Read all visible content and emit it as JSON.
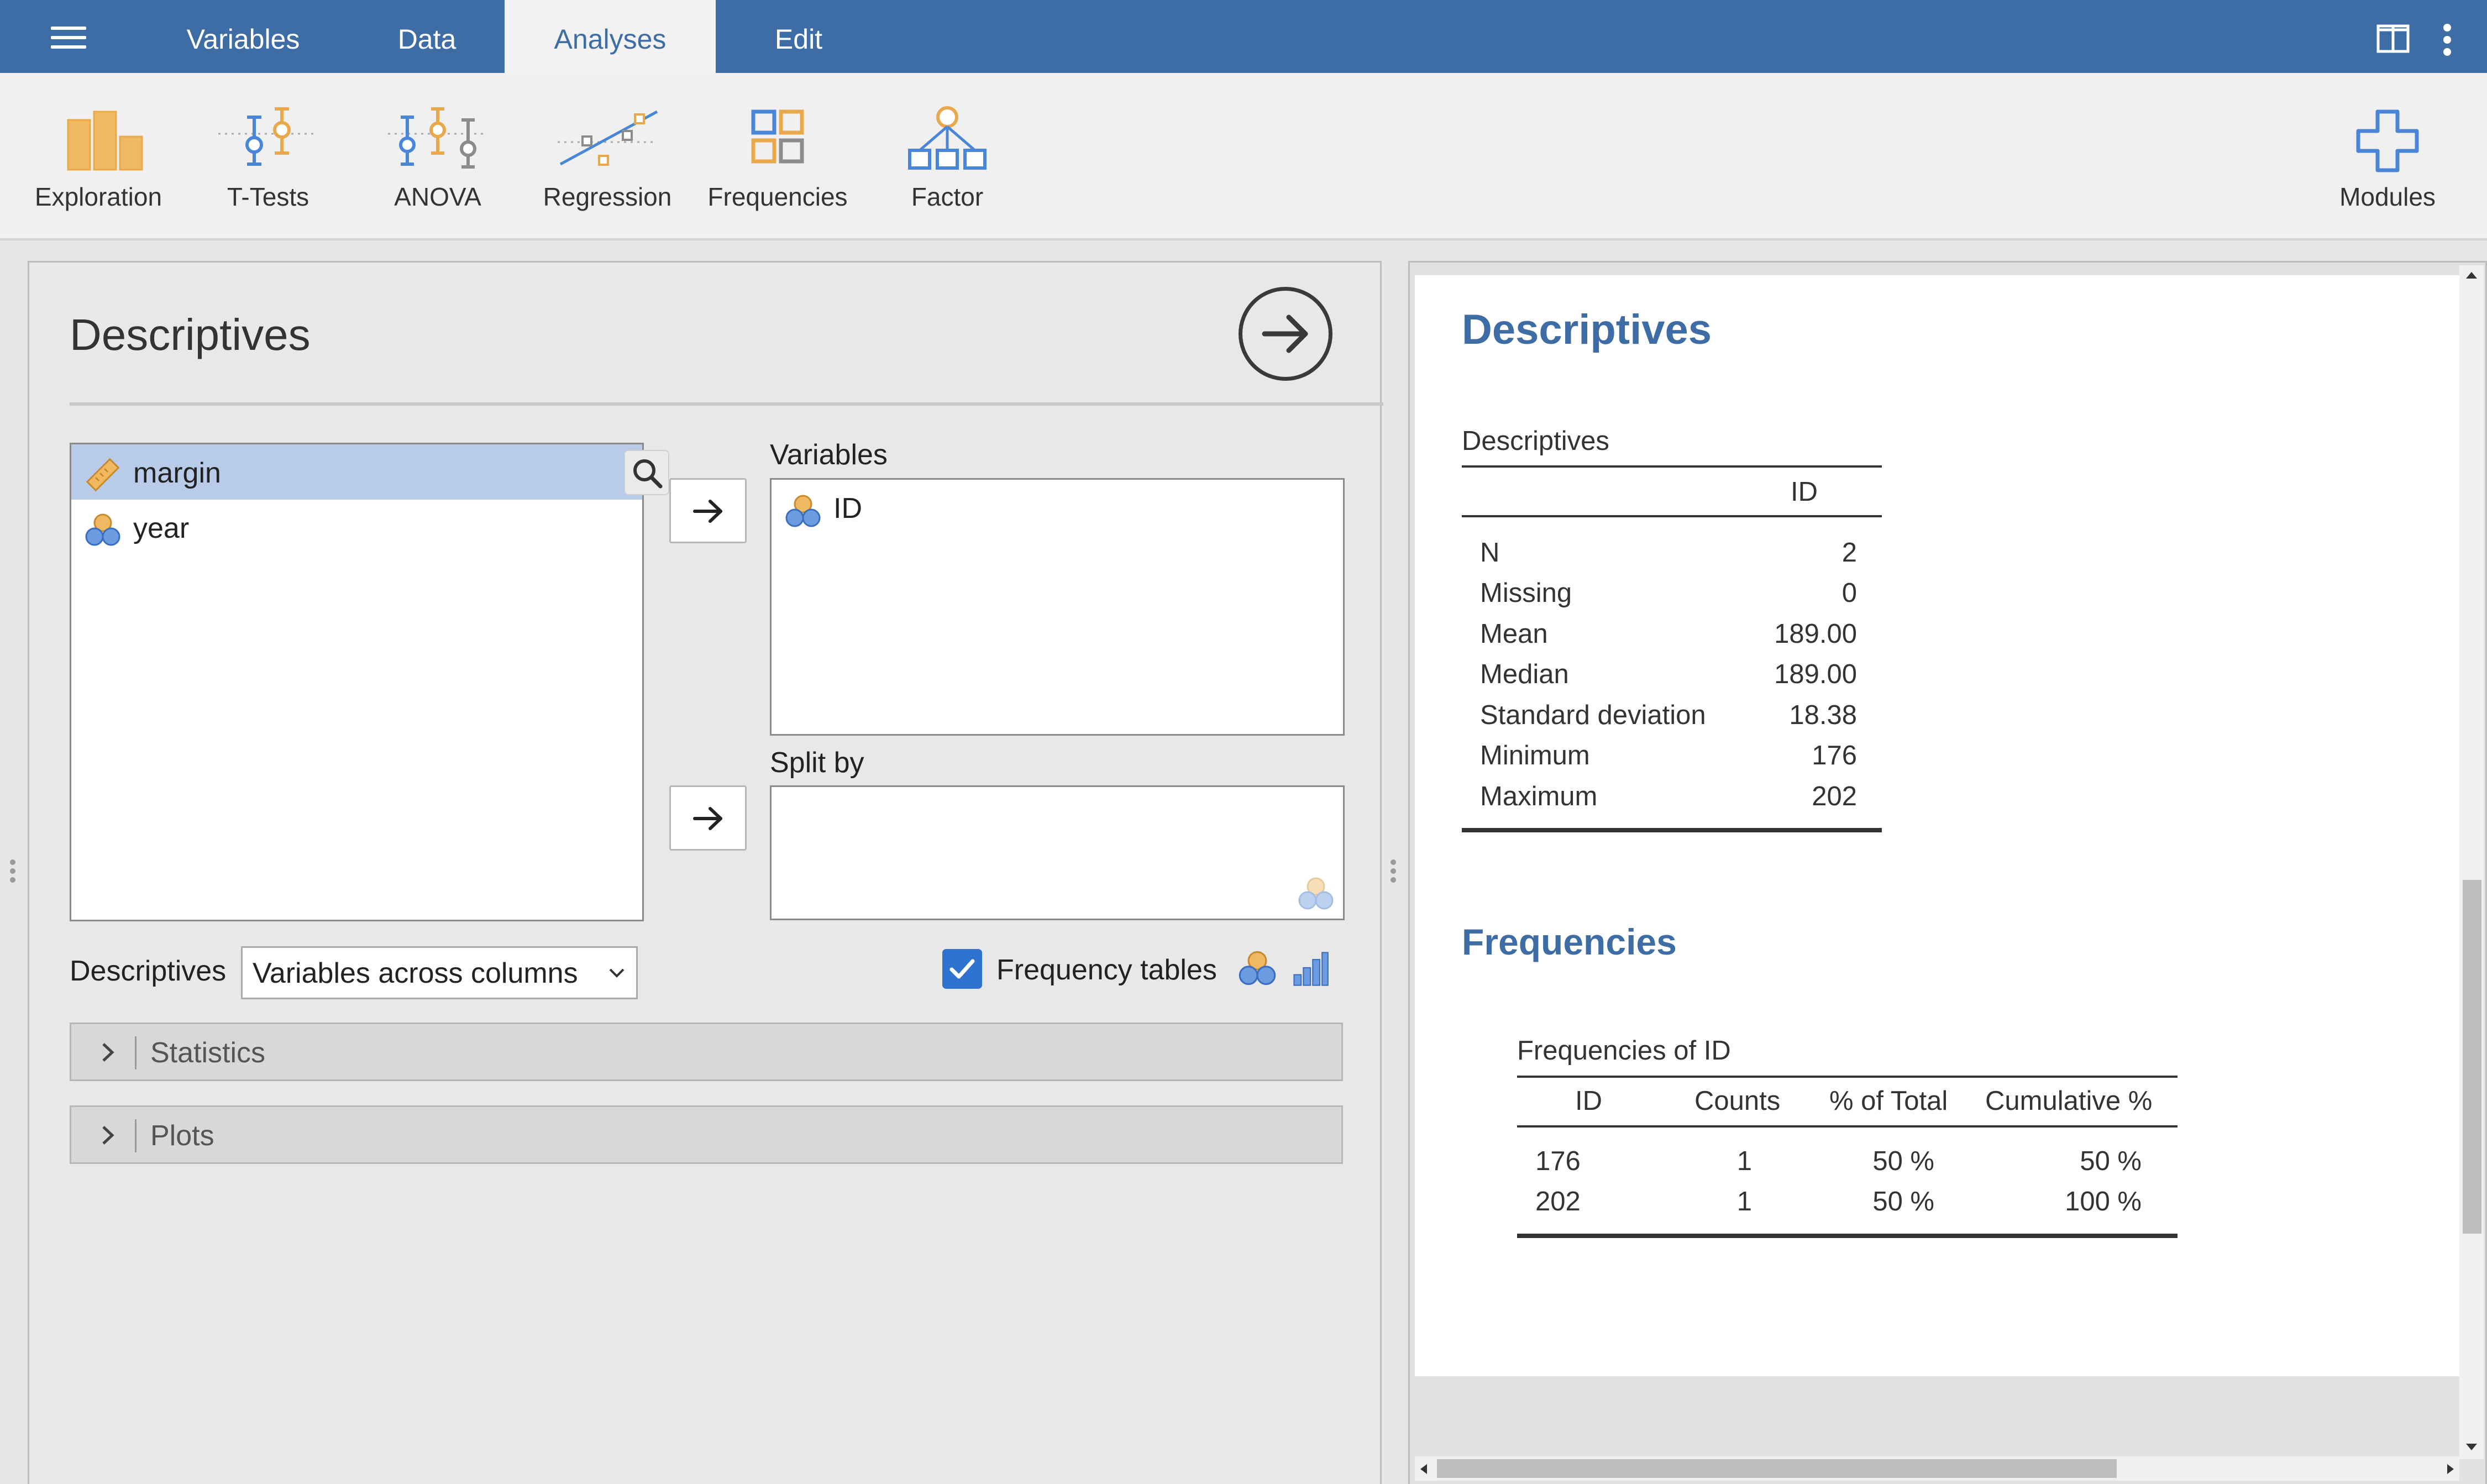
{
  "topbar": {
    "tabs": [
      {
        "label": "Variables"
      },
      {
        "label": "Data"
      },
      {
        "label": "Analyses"
      },
      {
        "label": "Edit"
      }
    ],
    "active_tab": "Analyses"
  },
  "ribbon": {
    "items": [
      {
        "label": "Exploration",
        "icon": "bar-chart-icon"
      },
      {
        "label": "T-Tests",
        "icon": "t-test-icon"
      },
      {
        "label": "ANOVA",
        "icon": "anova-icon"
      },
      {
        "label": "Regression",
        "icon": "regression-icon"
      },
      {
        "label": "Frequencies",
        "icon": "frequencies-icon"
      },
      {
        "label": "Factor",
        "icon": "factor-icon"
      }
    ],
    "modules_label": "Modules"
  },
  "options": {
    "title": "Descriptives",
    "source_vars": [
      {
        "name": "margin",
        "type": "continuous",
        "selected": true
      },
      {
        "name": "year",
        "type": "nominal",
        "selected": false
      }
    ],
    "variables_label": "Variables",
    "variables": [
      "ID"
    ],
    "split_by_label": "Split by",
    "descriptives_label": "Descriptives",
    "descriptives_select": "Variables across columns",
    "frequency_tables_label": "Frequency tables",
    "frequency_tables_checked": true,
    "sections": [
      "Statistics",
      "Plots"
    ]
  },
  "results": {
    "heading1": "Descriptives",
    "desc_table": {
      "title": "Descriptives",
      "column": "ID",
      "rows": [
        {
          "label": "N",
          "value": "2"
        },
        {
          "label": "Missing",
          "value": "0"
        },
        {
          "label": "Mean",
          "value": "189.00"
        },
        {
          "label": "Median",
          "value": "189.00"
        },
        {
          "label": "Standard deviation",
          "value": "18.38"
        },
        {
          "label": "Minimum",
          "value": "176"
        },
        {
          "label": "Maximum",
          "value": "202"
        }
      ]
    },
    "heading2": "Frequencies",
    "freq_table": {
      "title": "Frequencies of ID",
      "headers": [
        "ID",
        "Counts",
        "% of Total",
        "Cumulative %"
      ],
      "rows": [
        [
          "176",
          "1",
          "50 %",
          "50 %"
        ],
        [
          "202",
          "1",
          "50 %",
          "100 %"
        ]
      ]
    }
  },
  "colors": {
    "brand": "#3e6da6",
    "accent_orange": "#e9a84a",
    "accent_blue": "#4a86d8",
    "selected_row": "#b8cbe9"
  }
}
